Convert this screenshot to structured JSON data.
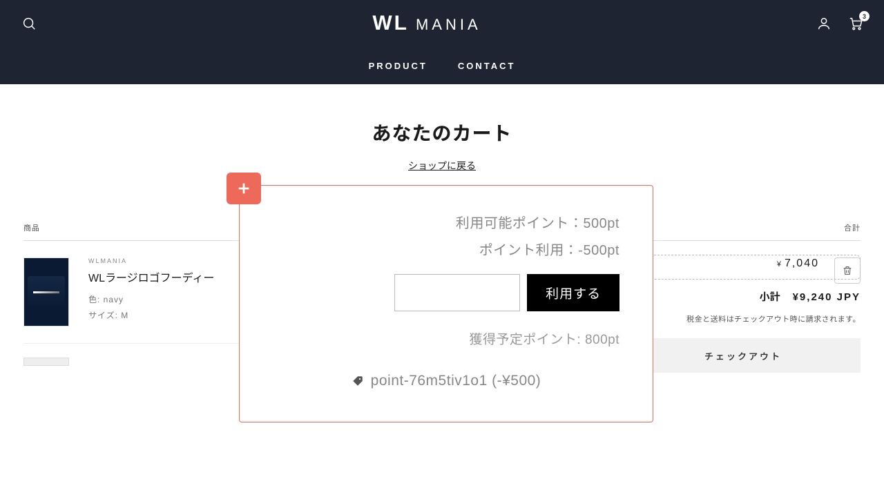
{
  "header": {
    "logo_main": "WL",
    "logo_sub": "MANIA",
    "cart_count": "3",
    "nav": {
      "product": "PRODUCT",
      "contact": "CONTACT"
    }
  },
  "page": {
    "title": "あなたのカート",
    "back_link": "ショップに戻る",
    "col_product": "商品",
    "col_total": "合計"
  },
  "item": {
    "vendor": "WLMANIA",
    "name": "WLラージロゴフーディー",
    "variant_color": "色: navy",
    "variant_size": "サイズ: M",
    "price_currency": "¥",
    "price_value": "7,040"
  },
  "points": {
    "available": "利用可能ポイント：500pt",
    "using": "ポイント利用：-500pt",
    "apply_label": "利用する",
    "earn": "獲得予定ポイント: 800pt",
    "coupon": "point-76m5tiv1o1 (-¥500)"
  },
  "summary": {
    "subtotal_label": "小計",
    "subtotal_value": "¥9,240 JPY",
    "tax_note": "税金と送料はチェックアウト時に請求されます。",
    "checkout": "チェックアウト"
  }
}
